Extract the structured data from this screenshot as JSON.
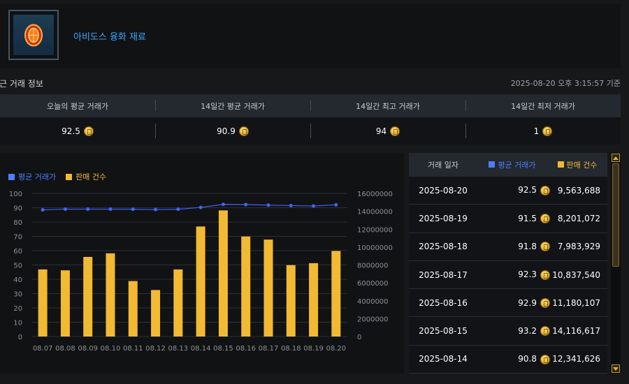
{
  "item": {
    "name": "아비도스 융화 재료"
  },
  "section": {
    "title": "최근 거래 정보",
    "timestamp": "2025-08-20 오후 3:15:57 기준"
  },
  "summary": {
    "headers": [
      "오늘의 평균 거래가",
      "14일간 평균 거래가",
      "14일간 최고 거래가",
      "14일간 최저 거래가"
    ],
    "values": [
      "92.5",
      "90.9",
      "94",
      "1"
    ]
  },
  "legend": {
    "avg_label": "평균 거래가",
    "count_label": "판매 건수"
  },
  "colors": {
    "avg": "#3f66f0",
    "count": "#f2b933",
    "accent": "#3aa8ff"
  },
  "chart_data": {
    "type": "bar",
    "categories": [
      "08.07",
      "08.08",
      "08.09",
      "08.10",
      "08.11",
      "08.12",
      "08.13",
      "08.14",
      "08.15",
      "08.16",
      "08.17",
      "08.18",
      "08.19",
      "08.20"
    ],
    "series": [
      {
        "name": "판매 건수",
        "type": "bar",
        "axis": "right",
        "values": [
          7500000,
          7400000,
          8900000,
          9300000,
          6200000,
          5200000,
          7500000,
          12300000,
          14100000,
          11180107,
          10837540,
          7983929,
          8201072,
          9563688
        ]
      },
      {
        "name": "평균 거래가",
        "type": "line",
        "axis": "left",
        "values": [
          88.5,
          89.0,
          89.0,
          89.0,
          88.9,
          88.7,
          88.9,
          90.2,
          92.3,
          92.2,
          91.8,
          91.5,
          91.2,
          92.0
        ]
      }
    ],
    "y_left": {
      "min": 0,
      "max": 100,
      "ticks": [
        "0",
        "10",
        "20",
        "30",
        "40",
        "50",
        "60",
        "70",
        "80",
        "90",
        "100"
      ]
    },
    "y_right": {
      "min": 0,
      "max": 16000000,
      "ticks": [
        "0",
        "2000000",
        "4000000",
        "6000000",
        "8000000",
        "10000000",
        "12000000",
        "14000000",
        "16000000"
      ]
    },
    "grid": true,
    "legend_position": "top-left"
  },
  "history": {
    "headers": {
      "date": "거래 일자",
      "avg": "평균 거래가",
      "count": "판매 건수"
    },
    "rows": [
      {
        "date": "2025-08-20",
        "avg": "92.5",
        "count": "9,563,688"
      },
      {
        "date": "2025-08-19",
        "avg": "91.5",
        "count": "8,201,072"
      },
      {
        "date": "2025-08-18",
        "avg": "91.8",
        "count": "7,983,929"
      },
      {
        "date": "2025-08-17",
        "avg": "92.3",
        "count": "10,837,540"
      },
      {
        "date": "2025-08-16",
        "avg": "92.9",
        "count": "11,180,107"
      },
      {
        "date": "2025-08-15",
        "avg": "93.2",
        "count": "14,116,617"
      },
      {
        "date": "2025-08-14",
        "avg": "90.8",
        "count": "12,341,626"
      }
    ]
  }
}
